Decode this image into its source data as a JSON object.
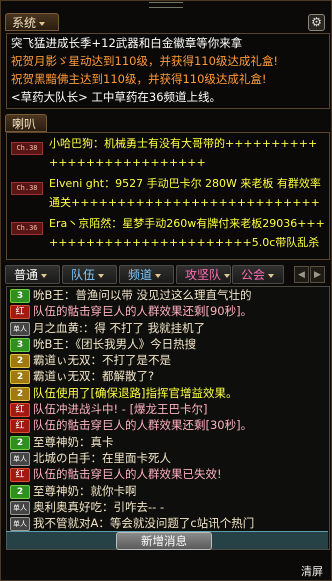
{
  "system": {
    "tab_label": "系统",
    "lines": [
      {
        "text": "突飞猛进成长季+12武器和白金徽章等你来拿",
        "color": "white"
      },
      {
        "text": "祝贺月影ゞ星动达到110级，并获得110级达成礼盒!",
        "color": "orange"
      },
      {
        "text": "祝贺黑黯佛主达到110级，并获得110级达成礼盒!",
        "color": "orange"
      },
      {
        "text": "<草药大队长> 工中草药在36频道上线。",
        "color": "white"
      }
    ]
  },
  "horn": {
    "tab_label": "喇叭",
    "lines": [
      {
        "badge": "Ch.38",
        "text": "小哈巴狗：机械勇士有没有大哥带的+++++++++++++++++++++++++++",
        "color": "yellow"
      },
      {
        "badge": "Ch.38",
        "text": "Elveni ght：9527 手动巴卡尔 280W 来老板 有群效率通关++++++++++++++++++++++++++++++++",
        "color": "yellow"
      },
      {
        "badge": "Ch.36",
        "text": "Era丶京陌然：星梦手动260w有牌付来老板29036+++++++++++++++++++++++++5.0c带队乱杀",
        "color": "yellow"
      }
    ]
  },
  "channel_tabs": [
    {
      "label": "普通",
      "color": "#ffffff"
    },
    {
      "label": "队伍",
      "color": "#7ec8ff"
    },
    {
      "label": "频道",
      "color": "#7ec8ff"
    },
    {
      "label": "攻坚队",
      "color": "#ff6fb8"
    },
    {
      "label": "公会",
      "color": "#ff6fb8"
    }
  ],
  "chat_lines": [
    {
      "badge": "3",
      "badge_color": "green",
      "text": "吮B王：普渔问以带 没见过这么理直气壮的",
      "color": "cream"
    },
    {
      "badge": "红",
      "badge_color": "red",
      "text": "队伍的骷击穿巨人的人群效果还剩[90秒]。",
      "color": "pink"
    },
    {
      "badge": "单人",
      "badge_color": "gray",
      "text": "月之血黄:：得 不打了 我就挂机了",
      "color": "cream"
    },
    {
      "badge": "3",
      "badge_color": "green",
      "text": "吮B王：《团长我男人》今日热搜",
      "color": "cream"
    },
    {
      "badge": "2",
      "badge_color": "gold",
      "text": "霸道ぃ无双：不打了是不是",
      "color": "cream"
    },
    {
      "badge": "2",
      "badge_color": "gold",
      "text": "霸道ぃ无双：都解散了?",
      "color": "cream"
    },
    {
      "badge": "2",
      "badge_color": "gold",
      "text": "队伍使用了[确保退路]指挥官增益效果。",
      "color": "yellow"
    },
    {
      "badge": "红",
      "badge_color": "red",
      "text": "队伍冲进战斗中! - [爆龙王巴卡尔]",
      "color": "pink"
    },
    {
      "badge": "红",
      "badge_color": "red",
      "text": "队伍的骷击穿巨人的人群效果还剩[30秒]。",
      "color": "pink"
    },
    {
      "badge": "2",
      "badge_color": "green",
      "text": "至尊神奶：真卡",
      "color": "cream"
    },
    {
      "badge": "单人",
      "badge_color": "gray",
      "text": "北城の白手：在里面卡死人",
      "color": "cream"
    },
    {
      "badge": "红",
      "badge_color": "red",
      "text": "队伍的骷击穿巨人的人群效果已失效!",
      "color": "pink"
    },
    {
      "badge": "2",
      "badge_color": "green",
      "text": "至尊神奶：就你卡啊",
      "color": "cream"
    },
    {
      "badge": "单人",
      "badge_color": "gray",
      "text": "奥利奥真好吃：引咋去-- -",
      "color": "cream"
    },
    {
      "badge": "单人",
      "badge_color": "gray",
      "text": "我不管就对A：等会就没问题了c站讯个热门",
      "color": "cream"
    }
  ],
  "new_message_label": "新增消息",
  "clear_label": "清屏",
  "icons": {
    "settings": "gear-icon",
    "scroll_left": "arrow-left-icon",
    "scroll_right": "arrow-right-icon",
    "dropdown": "chevron-down-icon"
  }
}
